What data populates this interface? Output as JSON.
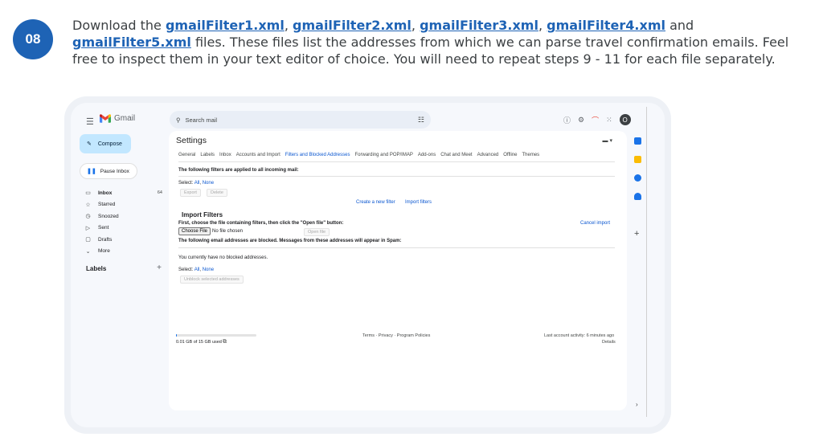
{
  "step": {
    "number": "08",
    "line1_prefix": "Download the ",
    "files": [
      "gmailFilter1.xml",
      "gmailFilter2.xml",
      "gmailFilter3.xml",
      "gmailFilter4.xml",
      "gmailFilter5.xml"
    ],
    "sep_comma": ", ",
    "sep_and": " and ",
    "line1_suffix": " files.",
    "body": "These files list the addresses from which we can parse travel confirmation emails. Feel free to inspect them in your text editor of choice. You will need to repeat steps 9 - 11 for each file separately."
  },
  "gmail": {
    "brand": "Gmail",
    "search_placeholder": "Search mail",
    "avatar_initial": "O",
    "compose_label": "Compose",
    "pause_label": "Pause Inbox",
    "nav": [
      {
        "label": "Inbox",
        "count": "64",
        "icon": "inbox-icon"
      },
      {
        "label": "Starred",
        "count": "",
        "icon": "star-icon"
      },
      {
        "label": "Snoozed",
        "count": "",
        "icon": "clock-icon"
      },
      {
        "label": "Sent",
        "count": "",
        "icon": "send-icon"
      },
      {
        "label": "Drafts",
        "count": "",
        "icon": "draft-icon"
      },
      {
        "label": "More",
        "count": "",
        "icon": "chevron-down-icon"
      }
    ],
    "labels_heading": "Labels"
  },
  "settings": {
    "title": "Settings",
    "tabs": [
      "General",
      "Labels",
      "Inbox",
      "Accounts and Import",
      "Filters and Blocked Addresses",
      "Forwarding and POP/IMAP",
      "Add-ons",
      "Chat and Meet",
      "Advanced",
      "Offline",
      "Themes"
    ],
    "active_tab_index": 4,
    "filters_heading": "The following filters are applied to all incoming mail:",
    "select_label": "Select: ",
    "select_all": "All",
    "select_sep": ", ",
    "select_none": "None",
    "export_btn": "Export",
    "delete_btn": "Delete",
    "create_filter": "Create a new filter",
    "import_filters_link": "Import filters",
    "import_heading": "Import Filters",
    "import_instructions": "First, choose the file containing filters, then click the \"Open file\" button:",
    "cancel_import": "Cancel import",
    "choose_file_btn": "Choose File",
    "no_file": "No file chosen",
    "open_file_btn": "Open file",
    "blocked_heading": "The following email addresses are blocked. Messages from these addresses will appear in Spam:",
    "no_blocked": "You currently have no blocked addresses.",
    "unblock_btn": "Unblock selected addresses",
    "storage_used": "0.01 GB of 15 GB used",
    "storage_fraction": 0.01,
    "footer_links": "Terms · Privacy · Program Policies",
    "last_activity": "Last account activity: 6 minutes ago",
    "details": "Details"
  }
}
